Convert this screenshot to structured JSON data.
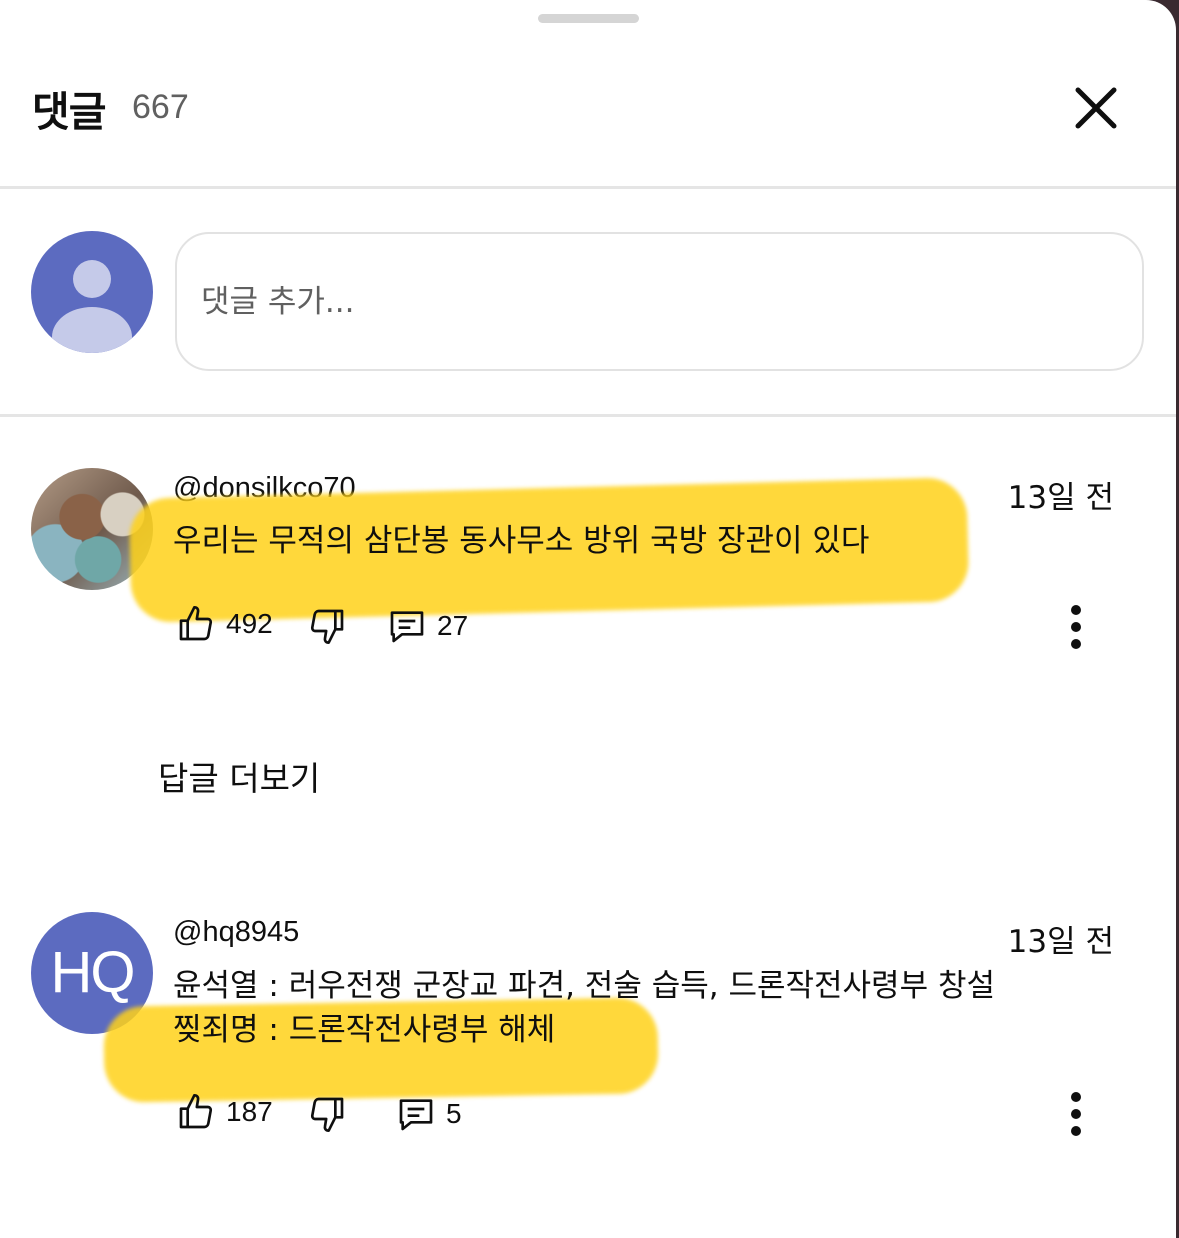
{
  "header": {
    "title": "댓글",
    "count": "667"
  },
  "composer": {
    "placeholder": "댓글 추가..."
  },
  "comments": [
    {
      "author": "@donsilkco70",
      "time": "13일 전",
      "lines": [
        "우리는 무적의 삼단봉 동사무소 방위 국방 장관이 있다"
      ],
      "likes": "492",
      "replies": "27",
      "avatar": "photo"
    },
    {
      "author": "@hq8945",
      "avatar_text": "HQ",
      "time": "13일 전",
      "lines": [
        "윤석열 : 러우전쟁 군장교 파견, 전술 습득,  드론작전사령부 창설",
        "찢죄명 : 드론작전사령부 해체"
      ],
      "likes": "187",
      "replies": "5"
    }
  ],
  "more_replies_label": "답글 더보기",
  "colors": {
    "highlight": "#ffd21a",
    "avatar_bg": "#5c6bc0"
  }
}
